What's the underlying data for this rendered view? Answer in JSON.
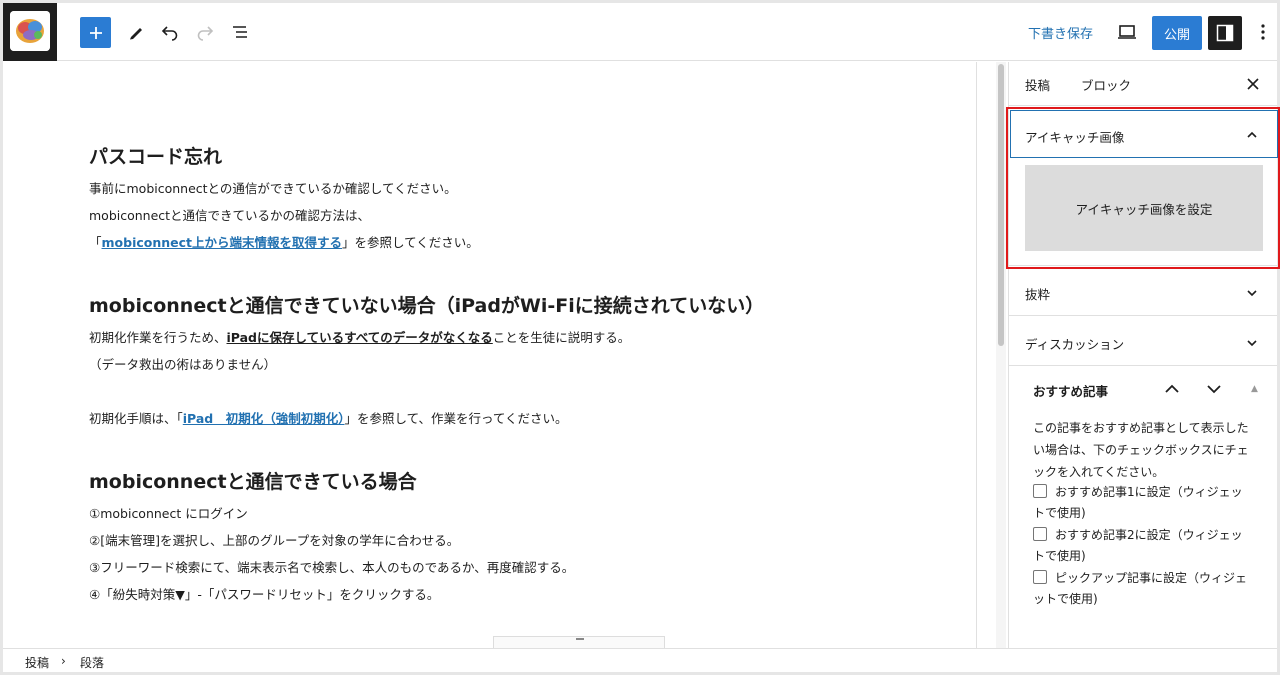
{
  "toolbar": {
    "save_draft_label": "下書き保存",
    "publish_label": "公開"
  },
  "editor": {
    "h1": "パスコード忘れ",
    "p1": "事前にmobiconnectとの通信ができているか確認してください。",
    "p2": "mobiconnectと通信できているかの確認方法は、",
    "p3_pre": "「",
    "p3_link": "mobiconnect上から端末情報を取得する",
    "p3_post": "」を参照してください。",
    "h2": "mobiconnectと通信できていない場合（iPadがWi-Fiに接続されていない）",
    "p4_pre": "初期化作業を行うため、",
    "p4_bold": "iPadに保存しているすべてのデータがなくなる",
    "p4_post": "ことを生徒に説明する。",
    "p5": "（データ救出の術はありません）",
    "p6_pre": "初期化手順は、「",
    "p6_link": "iPad　初期化（強制初期化）",
    "p6_post": "」を参照して、作業を行ってください。",
    "h3": "mobiconnectと通信できている場合",
    "steps": [
      "①mobiconnect にログイン",
      "②[端末管理]を選択し、上部のグループを対象の学年に合わせる。",
      "③フリーワード検索にて、端末表示名で検索し、本人のものであるか、再度確認する。",
      "④「紛失時対策▼」-「パスワードリセット」をクリックする。"
    ]
  },
  "sidebar": {
    "tab_post": "投稿",
    "tab_block": "ブロック",
    "featured_title": "アイキャッチ画像",
    "featured_button": "アイキャッチ画像を設定",
    "excerpt_title": "抜粋",
    "discussion_title": "ディスカッション",
    "recommend_title": "おすすめ記事",
    "recommend_desc": "この記事をおすすめ記事として表示したい場合は、下のチェックボックスにチェックを入れてください。",
    "checkboxes": [
      "おすすめ記事1に設定（ウィジェットで使用)",
      "おすすめ記事2に設定（ウィジェットで使用)",
      "ピックアップ記事に設定（ウィジェットで使用)"
    ]
  },
  "footer": {
    "crumb1": "投稿",
    "crumb_sep": "›",
    "crumb2": "段落"
  },
  "colors": {
    "accent": "#2b7cd3",
    "link": "#2271b1",
    "highlight": "#e0191b"
  }
}
